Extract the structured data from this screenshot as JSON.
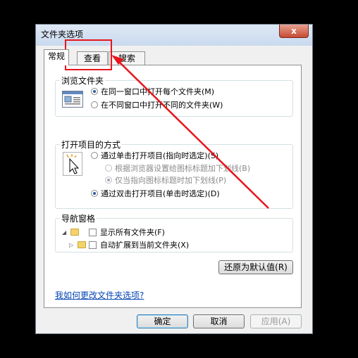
{
  "window": {
    "title": "文件夹选项",
    "close_label": "x"
  },
  "tabs": [
    {
      "label": "常规",
      "active": true
    },
    {
      "label": "查看",
      "active": false
    },
    {
      "label": "搜索",
      "active": false
    }
  ],
  "browse": {
    "title": "浏览文件夹",
    "options": [
      {
        "label": "在同一窗口中打开每个文件夹(M)",
        "checked": true
      },
      {
        "label": "在不同窗口中打开不同的文件夹(W)",
        "checked": false
      }
    ]
  },
  "click": {
    "title": "打开项目的方式",
    "options": [
      {
        "label": "通过单击打开项目(指向时选定)(S)",
        "checked": false,
        "disabled": false
      },
      {
        "label": "根据浏览器设置给图标标题加下划线(B)",
        "checked": false,
        "disabled": true
      },
      {
        "label": "仅当指向图标标题时加下划线(P)",
        "checked": true,
        "disabled": true
      },
      {
        "label": "通过双击打开项目(单击时选定)(D)",
        "checked": true,
        "disabled": false
      }
    ]
  },
  "nav": {
    "title": "导航窗格",
    "options": [
      {
        "label": "显示所有文件夹(F)",
        "checked": false
      },
      {
        "label": "自动扩展到当前文件夹(X)",
        "checked": false
      }
    ]
  },
  "restore_button": "还原为默认值(R)",
  "help_link": "我如何更改文件夹选项?",
  "buttons": {
    "ok": "确定",
    "cancel": "取消",
    "apply": "应用(A)"
  },
  "annotation_color": "#e8141c"
}
